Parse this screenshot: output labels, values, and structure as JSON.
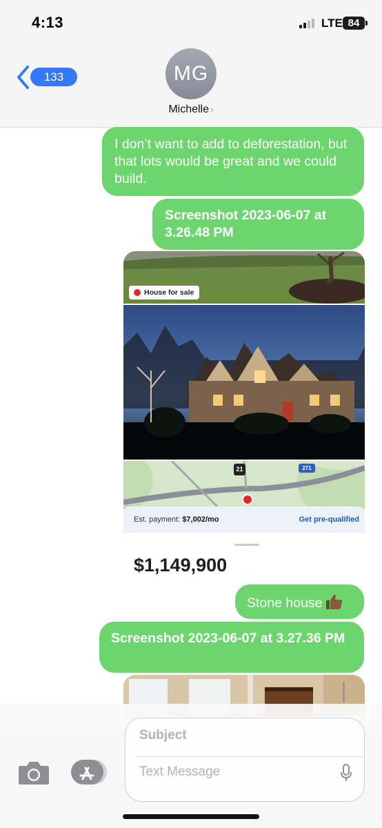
{
  "status_bar": {
    "time": "4:13",
    "network": "LTE",
    "battery": "84"
  },
  "header": {
    "back_count": "133",
    "avatar_initials": "MG",
    "contact_name": "Michelle",
    "contact_chevron": "›"
  },
  "messages": [
    {
      "text": "I don’t want to add to deforestation, but that lots would be great and we could build."
    },
    {
      "text": "Screenshot 2023-06-07 at 3.26.48 PM"
    },
    {
      "text": "Stone house"
    },
    {
      "text": "Screenshot 2023-06-07 at 3.27.36 PM"
    }
  ],
  "listing": {
    "badge": "House for sale",
    "route_shield": "21",
    "interstate_shield": "271",
    "payment_label": "Est. payment: ",
    "payment_value": "$7,002/mo",
    "prequal_label": "Get pre-qualified",
    "price": "$1,149,900"
  },
  "compose": {
    "subject_placeholder": "Subject",
    "text_placeholder": "Text Message"
  },
  "colors": {
    "bubble_green": "#6cd56e",
    "ios_blue": "#3478f6",
    "badge_red": "#e52535"
  },
  "icons": [
    "back-chevron-icon",
    "thumbs-up-icon",
    "camera-icon",
    "app-store-icon",
    "microphone-icon"
  ]
}
